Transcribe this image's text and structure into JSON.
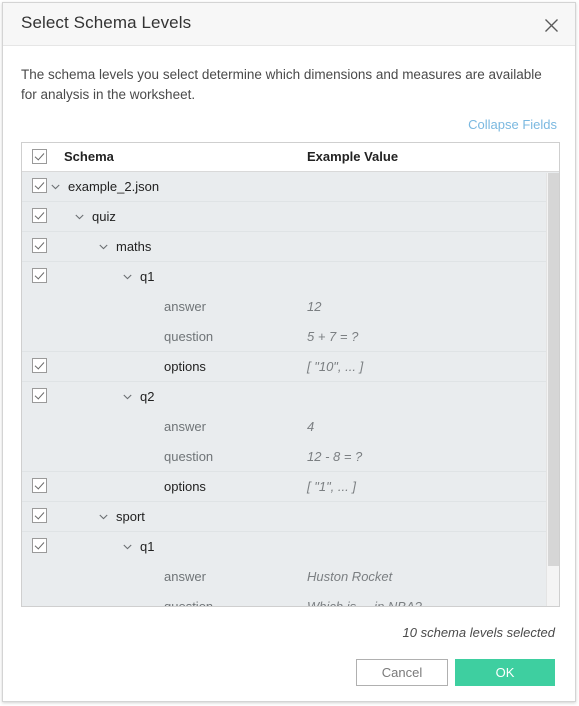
{
  "dialog": {
    "title": "Select Schema Levels",
    "close_icon": "close-icon",
    "description": "The schema levels you select determine which dimensions and measures are available for analysis in the worksheet.",
    "collapse_link": "Collapse Fields"
  },
  "table": {
    "header": {
      "checkbox_checked": true,
      "schema_column": "Schema",
      "value_column": "Example Value"
    },
    "rows": [
      {
        "label": "example_2.json",
        "value": "",
        "indent": 0,
        "checkbox": true,
        "checked": true,
        "chevron": true,
        "muted": false,
        "separator": true
      },
      {
        "label": "quiz",
        "value": "",
        "indent": 1,
        "checkbox": true,
        "checked": true,
        "chevron": true,
        "muted": false,
        "separator": true
      },
      {
        "label": "maths",
        "value": "",
        "indent": 2,
        "checkbox": true,
        "checked": true,
        "chevron": true,
        "muted": false,
        "separator": true
      },
      {
        "label": "q1",
        "value": "",
        "indent": 3,
        "checkbox": true,
        "checked": true,
        "chevron": true,
        "muted": false,
        "separator": false
      },
      {
        "label": "answer",
        "value": "12",
        "indent": 4,
        "checkbox": false,
        "checked": false,
        "chevron": false,
        "muted": true,
        "separator": false
      },
      {
        "label": "question",
        "value": "5 + 7 = ?",
        "indent": 4,
        "checkbox": false,
        "checked": false,
        "chevron": false,
        "muted": true,
        "separator": true
      },
      {
        "label": "options",
        "value": "[ \"10\", ... ]",
        "indent": 4,
        "checkbox": true,
        "checked": true,
        "chevron": false,
        "muted": false,
        "separator": true
      },
      {
        "label": "q2",
        "value": "",
        "indent": 3,
        "checkbox": true,
        "checked": true,
        "chevron": true,
        "muted": false,
        "separator": false
      },
      {
        "label": "answer",
        "value": "4",
        "indent": 4,
        "checkbox": false,
        "checked": false,
        "chevron": false,
        "muted": true,
        "separator": false
      },
      {
        "label": "question",
        "value": "12 - 8 = ?",
        "indent": 4,
        "checkbox": false,
        "checked": false,
        "chevron": false,
        "muted": true,
        "separator": true
      },
      {
        "label": "options",
        "value": "[ \"1\", ... ]",
        "indent": 4,
        "checkbox": true,
        "checked": true,
        "chevron": false,
        "muted": false,
        "separator": true
      },
      {
        "label": "sport",
        "value": "",
        "indent": 2,
        "checkbox": true,
        "checked": true,
        "chevron": true,
        "muted": false,
        "separator": true
      },
      {
        "label": "q1",
        "value": "",
        "indent": 3,
        "checkbox": true,
        "checked": true,
        "chevron": true,
        "muted": false,
        "separator": false
      },
      {
        "label": "answer",
        "value": "Huston Rocket",
        "indent": 4,
        "checkbox": false,
        "checked": false,
        "chevron": false,
        "muted": true,
        "separator": false
      },
      {
        "label": "question",
        "value": "Which is ... in NBA?",
        "indent": 4,
        "checkbox": false,
        "checked": false,
        "chevron": false,
        "muted": true,
        "separator": false
      }
    ]
  },
  "footer": {
    "selected_count": "10 schema levels selected",
    "cancel_label": "Cancel",
    "ok_label": "OK"
  },
  "colors": {
    "accent_ok": "#3ecfa0",
    "link": "#7ab8e0",
    "row_bg": "#e9ecee",
    "titlebar_bg": "#f7f7f7"
  }
}
